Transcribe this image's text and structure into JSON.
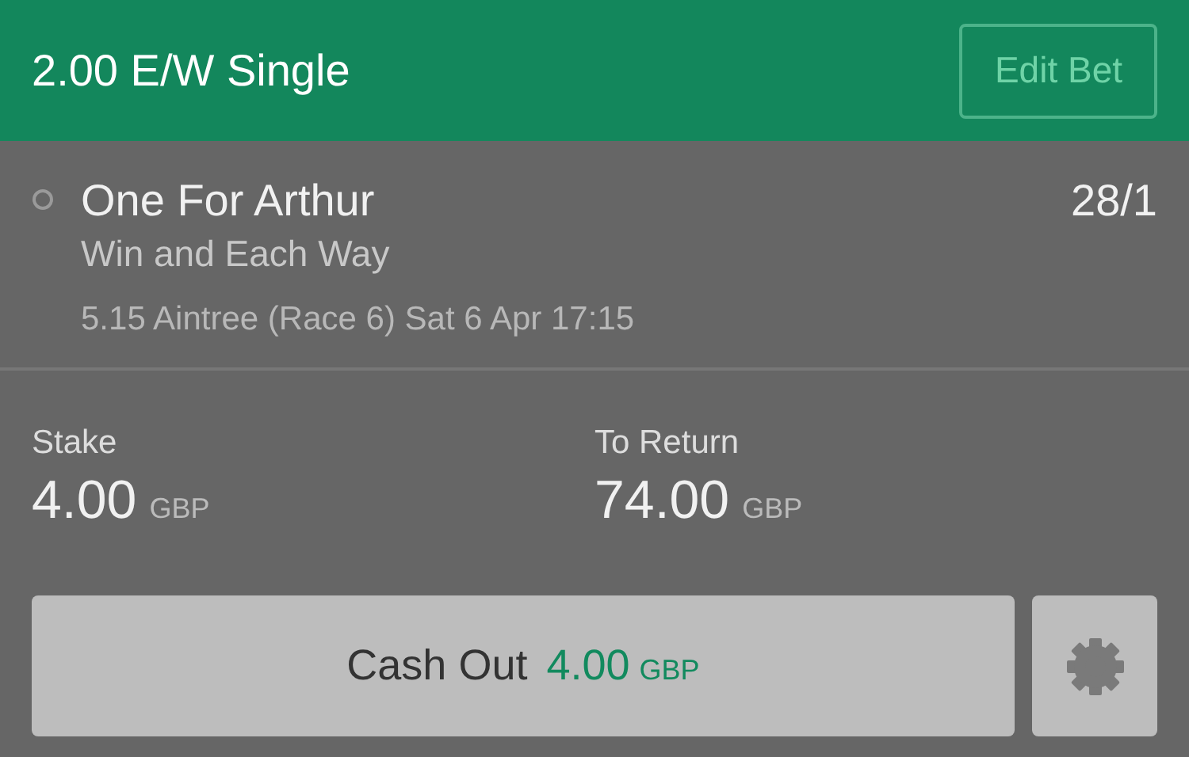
{
  "header": {
    "title": "2.00 E/W Single",
    "edit_button": "Edit Bet"
  },
  "selection": {
    "name": "One For Arthur",
    "odds": "28/1",
    "market": "Win and Each Way",
    "event": "5.15 Aintree (Race 6) Sat 6 Apr 17:15"
  },
  "stake": {
    "label": "Stake",
    "amount": "4.00",
    "currency": "GBP"
  },
  "to_return": {
    "label": "To Return",
    "amount": "74.00",
    "currency": "GBP"
  },
  "cash_out": {
    "label": "Cash Out",
    "amount": "4.00",
    "currency": "GBP"
  }
}
